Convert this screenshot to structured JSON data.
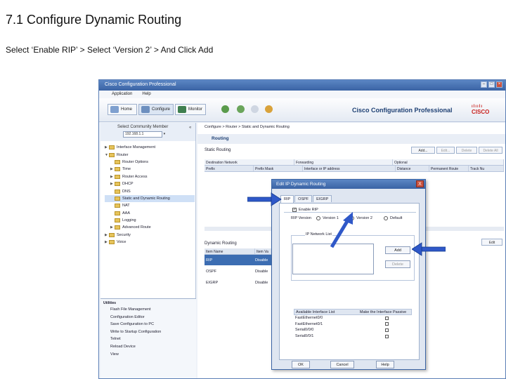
{
  "slide": {
    "title": "7.1 Configure Dynamic Routing",
    "subtitle": "Select ‘Enable RIP’ > Select ‘Version 2’ > And Click Add"
  },
  "window": {
    "title": "Cisco Configuration Professional",
    "menu": [
      "Application",
      "Help"
    ],
    "toolbar": {
      "home": "Home",
      "configure": "Configure",
      "monitor": "Monitor"
    },
    "brand": "Cisco Configuration Professional",
    "cisco_logo": "CISCO"
  },
  "left": {
    "community_label": "Select Community Member",
    "community_value": "192.168.1.1",
    "collapse": "«",
    "tree": [
      {
        "label": "Interface Management",
        "indent": 0,
        "exp": "▶"
      },
      {
        "label": "Router",
        "indent": 0,
        "exp": "▼"
      },
      {
        "label": "Router Options",
        "indent": 1,
        "exp": ""
      },
      {
        "label": "Time",
        "indent": 1,
        "exp": "▶"
      },
      {
        "label": "Router Access",
        "indent": 1,
        "exp": "▶"
      },
      {
        "label": "DHCP",
        "indent": 1,
        "exp": "▶"
      },
      {
        "label": "DNS",
        "indent": 1,
        "exp": ""
      },
      {
        "label": "Static and Dynamic Routing",
        "indent": 1,
        "exp": "",
        "selected": true
      },
      {
        "label": "NAT",
        "indent": 1,
        "exp": ""
      },
      {
        "label": "AAA",
        "indent": 1,
        "exp": ""
      },
      {
        "label": "Logging",
        "indent": 1,
        "exp": ""
      },
      {
        "label": "Advanced Route",
        "indent": 1,
        "exp": "▶"
      },
      {
        "label": "Security",
        "indent": 0,
        "exp": "▶"
      },
      {
        "label": "Voice",
        "indent": 0,
        "exp": "▶"
      }
    ],
    "utilities_title": "Utilities",
    "utilities": [
      "Flash File Management",
      "Configuration Editor",
      "Save Configuration to PC",
      "Write to Startup Configuration",
      "Telnet",
      "Reload Device",
      "View"
    ]
  },
  "right": {
    "breadcrumb": "Configure > Router > Static and Dynamic Routing",
    "header": "Routing",
    "static_title": "Static Routing",
    "static_buttons": [
      "Add...",
      "Edit...",
      "Delete",
      "Delete All"
    ],
    "static_groups": [
      "Destination Network",
      "Forwarding",
      "Optional"
    ],
    "static_columns": [
      "Prefix",
      "Prefix Mask",
      "Interface or IP address",
      "Distance",
      "Permanent Route",
      "Track Nu"
    ],
    "dynamic_title": "Dynamic Routing",
    "dynamic_edit": "Edit",
    "dynamic_columns": [
      "Item Name",
      "Item Va"
    ],
    "dynamic_rows": [
      {
        "name": "RIP",
        "value": "Disable",
        "selected": true
      },
      {
        "name": "OSPF",
        "value": "Disable"
      },
      {
        "name": "EIGRP",
        "value": "Disable"
      }
    ]
  },
  "dialog": {
    "title": "Edit IP Dynamic Routing",
    "close": "X",
    "tabs": [
      "RIP",
      "OSPF",
      "EIGRP"
    ],
    "enable_rip": "Enable RIP",
    "rip_version_label": "RIP Version",
    "versions": [
      "Version 1",
      "Version 2",
      "Default"
    ],
    "selected_version": "Version 2",
    "network_list_title": "IP Network List",
    "add": "Add",
    "delete": "Delete",
    "interface_columns": [
      "Available Interface List",
      "Make the Interface Passive"
    ],
    "interfaces": [
      "FastEthernet0/0",
      "FastEthernet0/1",
      "Serial0/0/0",
      "Serial0/0/1"
    ],
    "ok": "OK",
    "cancel": "Cancel",
    "help": "Help"
  },
  "colors": {
    "title_bar": "#3a63a4",
    "selection": "#3c6db2",
    "arrow": "#2f58c8",
    "cisco_red": "#c9211e"
  }
}
